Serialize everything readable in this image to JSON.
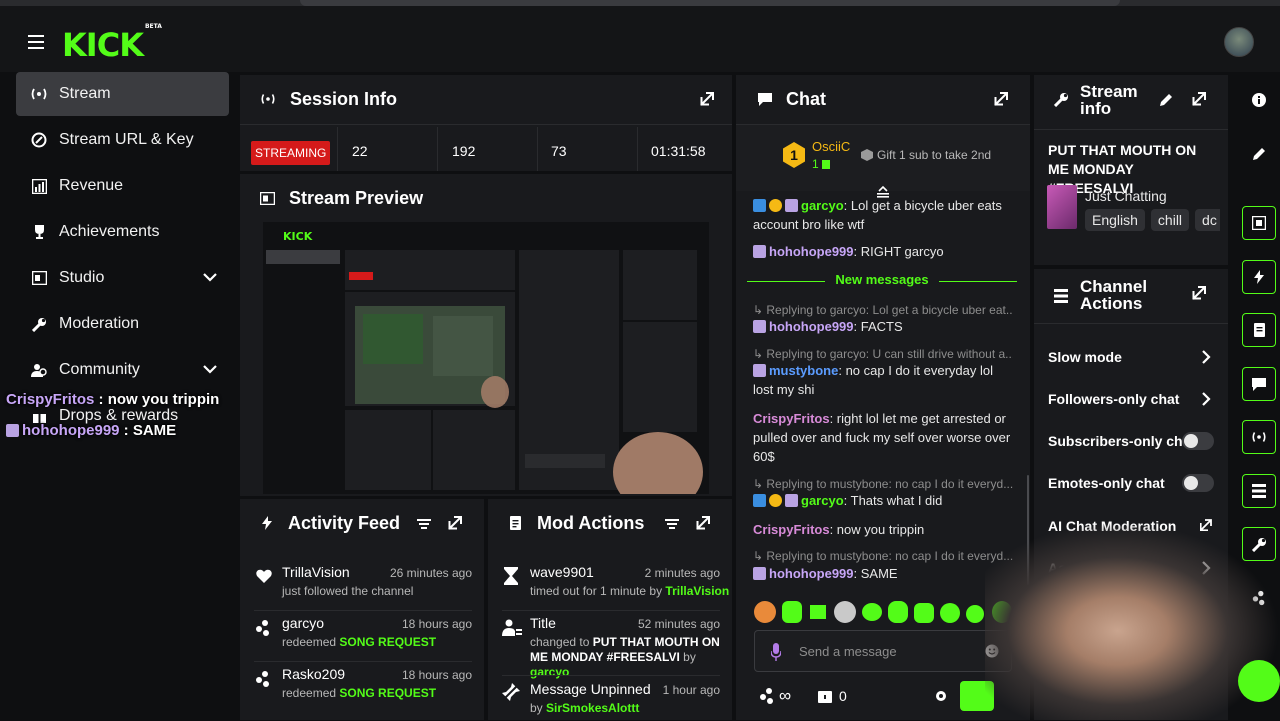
{
  "app": {
    "logo": "KICK",
    "logo_badge": "BETA"
  },
  "sidebar": {
    "items": [
      {
        "label": "Stream",
        "icon": "broadcast-icon"
      },
      {
        "label": "Stream URL & Key",
        "icon": "link-icon"
      },
      {
        "label": "Revenue",
        "icon": "chart-icon"
      },
      {
        "label": "Achievements",
        "icon": "trophy-icon"
      },
      {
        "label": "Studio",
        "icon": "studio-icon"
      },
      {
        "label": "Moderation",
        "icon": "wrench-icon"
      },
      {
        "label": "Community",
        "icon": "people-icon"
      },
      {
        "label": "Drops & rewards",
        "icon": "gift-icon"
      }
    ]
  },
  "overlay_chat": [
    {
      "user": "CrispyFritos",
      "text": " : now you trippin"
    },
    {
      "user": "hohohope999",
      "text": " : SAME"
    }
  ],
  "session": {
    "title": "Session Info",
    "status": "STREAMING",
    "stats": [
      "22",
      "192",
      "73",
      "01:31:58"
    ]
  },
  "preview": {
    "title": "Stream Preview"
  },
  "activity": {
    "title": "Activity Feed",
    "items": [
      {
        "name": "TrillaVision",
        "time": "26 minutes ago",
        "sub": "just followed the channel",
        "highlight": ""
      },
      {
        "name": "garcyo",
        "time": "18 hours ago",
        "sub": "redeemed ",
        "highlight": "SONG REQUEST"
      },
      {
        "name": "Rasko209",
        "time": "18 hours ago",
        "sub": "redeemed ",
        "highlight": "SONG REQUEST"
      }
    ]
  },
  "mod_actions": {
    "title": "Mod Actions",
    "items": [
      {
        "name": "wave9901",
        "time": "2 minutes ago",
        "sub": "timed out for 1 minute by ",
        "by": "TrillaVision"
      },
      {
        "name": "Title",
        "time": "52 minutes ago",
        "sub_pre": "changed to ",
        "sub_bold": "PUT THAT MOUTH ON ME MONDAY #FREESALVI",
        "sub_mid": " by ",
        "by": "garcyo"
      },
      {
        "name": "Message Unpinned",
        "time": "1 hour ago",
        "sub": "by ",
        "by": "SirSmokesAlottt"
      }
    ]
  },
  "chat": {
    "title": "Chat",
    "top_gifter": {
      "name": "OsciiC",
      "count": "1",
      "rank": "1"
    },
    "gift_prompt": "Gift 1 sub to take 2nd",
    "messages": [
      {
        "reply": "",
        "user": "garcyo",
        "text": ": Lol get a bicycle uber eats account bro like wtf"
      },
      {
        "reply": "",
        "user": "hohohope999",
        "text": ": RIGHT garcyo"
      },
      {
        "reply": "Replying to garcyo: Lol get a bicycle uber eat...",
        "user": "hohohope999",
        "text": ": FACTS"
      },
      {
        "reply": "Replying to garcyo: U can still drive without a...",
        "user": "mustybone",
        "text": ": no cap I do it everyday lol lost my shi"
      },
      {
        "reply": "",
        "user": "CrispyFritos",
        "text": ": right lol let me get arrested or pulled over and fuck my self over worse over 60$"
      },
      {
        "reply": "Replying to mustybone: no cap I do it everyd...",
        "user": "garcyo",
        "text": ": Thats what I did"
      },
      {
        "reply": "",
        "user": "CrispyFritos",
        "text": ": now you trippin"
      },
      {
        "reply": "Replying to mustybone: no cap I do it everyd...",
        "user": "hohohope999",
        "text": ": SAME"
      }
    ],
    "new_messages_label": "New messages",
    "input_placeholder": "Send a message",
    "footer": {
      "points": "∞",
      "count": "0"
    }
  },
  "stream_info": {
    "title": "Stream info",
    "stream_title": "PUT THAT MOUTH ON ME MONDAY #FREESALVI",
    "category": "Just Chatting",
    "tags": [
      "English",
      "chill",
      "dc"
    ]
  },
  "channel_actions": {
    "title": "Channel Actions",
    "items": [
      {
        "label": "Slow mode",
        "control": "chevron"
      },
      {
        "label": "Followers-only chat",
        "control": "chevron"
      },
      {
        "label": "Subscribers-only chat",
        "control": "toggle"
      },
      {
        "label": "Emotes-only chat",
        "control": "toggle"
      },
      {
        "label": "AI Chat Moderation",
        "control": "external"
      },
      {
        "label": "Ac",
        "control": "chevron"
      },
      {
        "label": "B",
        "control": "chevron"
      }
    ]
  },
  "colors": {
    "accent": "#53fc18",
    "live": "#d51a1a",
    "panel": "#191a1d",
    "bg": "#0e0f11"
  }
}
